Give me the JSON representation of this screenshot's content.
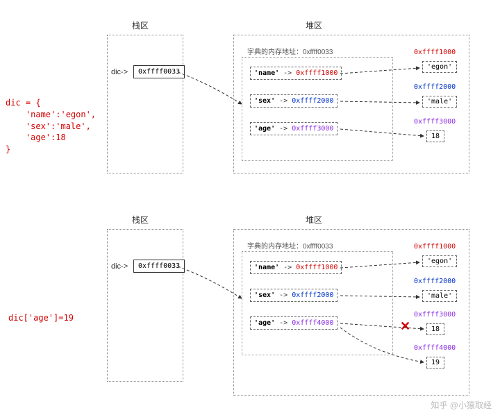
{
  "labels": {
    "stack": "栈区",
    "heap": "堆区",
    "heap_header_prefix": "字典的内存地址：",
    "var_arrow": "dic->"
  },
  "common": {
    "dict_addr": "0xffff0033",
    "addr_name": "0xffff1000",
    "addr_sex": "0xffff2000",
    "addr_age_old": "0xffff3000",
    "addr_age_new": "0xffff4000",
    "key_name": "'name'",
    "key_sex": "'sex'",
    "key_age": "'age'",
    "val_name": "'egon'",
    "val_sex": "'male'",
    "val_age_old": "18",
    "val_age_new": "19",
    "arrow": " -> "
  },
  "row1": {
    "code": "dic = {\n    'name':'egon',\n    'sex':'male',\n    'age':18\n}"
  },
  "row2": {
    "code": "dic['age']=19"
  },
  "watermark": "知乎 @小猿取经"
}
